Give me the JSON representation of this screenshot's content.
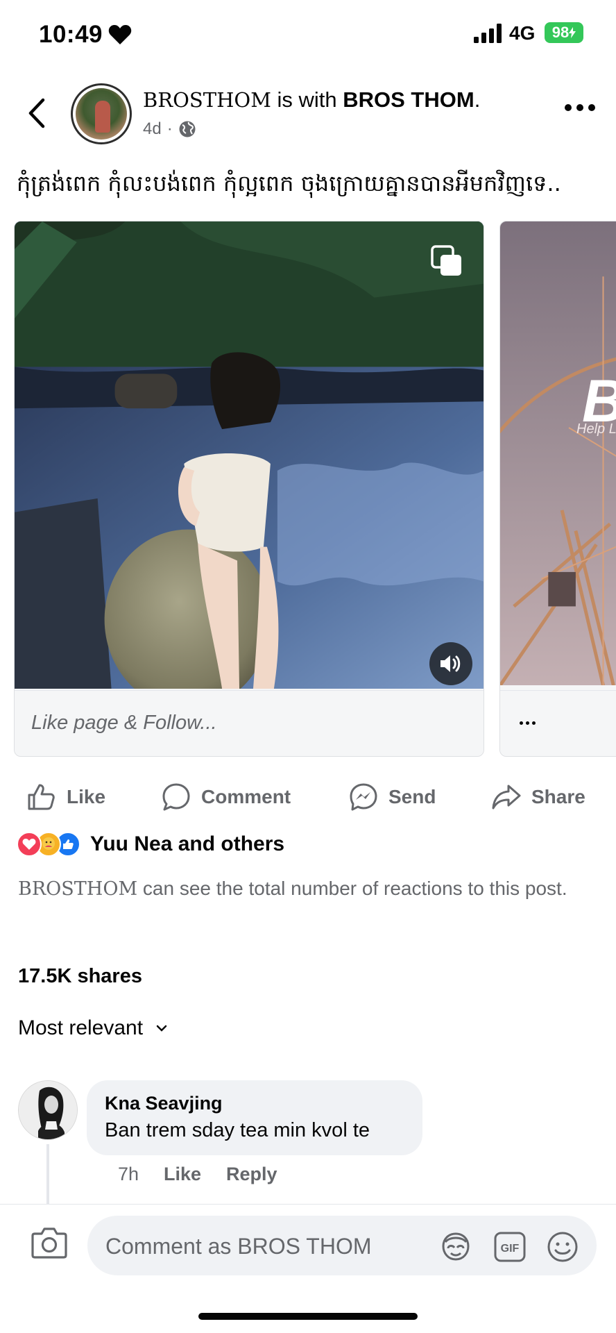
{
  "status_bar": {
    "time": "10:49",
    "network": "4G",
    "battery": "98",
    "icons": [
      "heart-icon",
      "cellular-signal-icon",
      "battery-charging-icon"
    ]
  },
  "post": {
    "author_mono": "BROSTHOM",
    "with_text": " is with ",
    "tagged": "BROS THOM",
    "period": ".",
    "age": "4d",
    "separator": "·",
    "caption": "កុំត្រង់ពេក កុំលះបង់ពេក កុំល្អពេក ចុងក្រោយគ្នានបានអីមកវិញទេ..",
    "cards": [
      {
        "footer": "Like page & Follow...",
        "has_video_sound": true
      },
      {
        "overlay_letter": "B",
        "overlay_sub": "Help L",
        "footer": "..."
      }
    ]
  },
  "actions": {
    "like": "Like",
    "comment": "Comment",
    "send": "Send",
    "share": "Share"
  },
  "reactions": {
    "types": [
      "love",
      "care",
      "like"
    ],
    "summary": "Yuu Nea and others"
  },
  "privacy_note": {
    "page": "BROSTHOM",
    "text": " can see the total number of reactions to this post."
  },
  "shares": "17.5K shares",
  "sort_label": "Most relevant",
  "comments": [
    {
      "author": "Kna Seavjing",
      "text": "Ban trem sday tea min kvol te",
      "time": "7h",
      "like": "Like",
      "reply": "Reply"
    }
  ],
  "composer": {
    "placeholder": "Comment as BROS THOM",
    "gif_label": "GIF"
  },
  "colors": {
    "text": "#050505",
    "secondary": "#65676b",
    "bubble": "#f0f2f5",
    "battery": "#34c759",
    "like_blue": "#1877f2",
    "love_red": "#f33e58"
  }
}
